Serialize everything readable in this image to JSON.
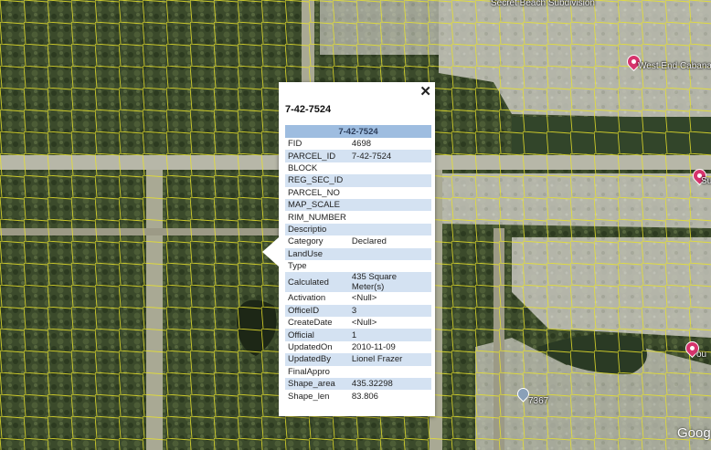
{
  "map": {
    "labels": {
      "secret_beach": "Secret Beach Subdivision",
      "west_end": "West End Cabanas",
      "right_label": "Su",
      "right_label2": "ou",
      "parcel_marker": "7367",
      "google": "Goog"
    },
    "colors": {
      "parcel_lines": "#e8e22a",
      "pin": "#d6336c"
    }
  },
  "popup": {
    "title": "7-42-7524",
    "close_symbol": "✕",
    "table_header": "7-42-7524",
    "rows": [
      {
        "key": "FID",
        "value": "4698"
      },
      {
        "key": "PARCEL_ID",
        "value": "7-42-7524"
      },
      {
        "key": "BLOCK",
        "value": ""
      },
      {
        "key": "REG_SEC_ID",
        "value": ""
      },
      {
        "key": "PARCEL_NO",
        "value": ""
      },
      {
        "key": "MAP_SCALE",
        "value": ""
      },
      {
        "key": "RIM_NUMBER",
        "value": ""
      },
      {
        "key": "Descriptio",
        "value": ""
      },
      {
        "key": "Category",
        "value": "Declared"
      },
      {
        "key": "LandUse",
        "value": ""
      },
      {
        "key": "Type",
        "value": ""
      },
      {
        "key": "Calculated",
        "value": "435 Square Meter(s)"
      },
      {
        "key": "Activation",
        "value": "<Null>"
      },
      {
        "key": "OfficeID",
        "value": "3"
      },
      {
        "key": "CreateDate",
        "value": "<Null>"
      },
      {
        "key": "Official",
        "value": "1"
      },
      {
        "key": "UpdatedOn",
        "value": "2010-11-09"
      },
      {
        "key": "UpdatedBy",
        "value": "Lionel Frazer"
      },
      {
        "key": "FinalAppro",
        "value": ""
      },
      {
        "key": "Shape_area",
        "value": "435.32298"
      },
      {
        "key": "Shape_len",
        "value": "83.806"
      }
    ]
  }
}
